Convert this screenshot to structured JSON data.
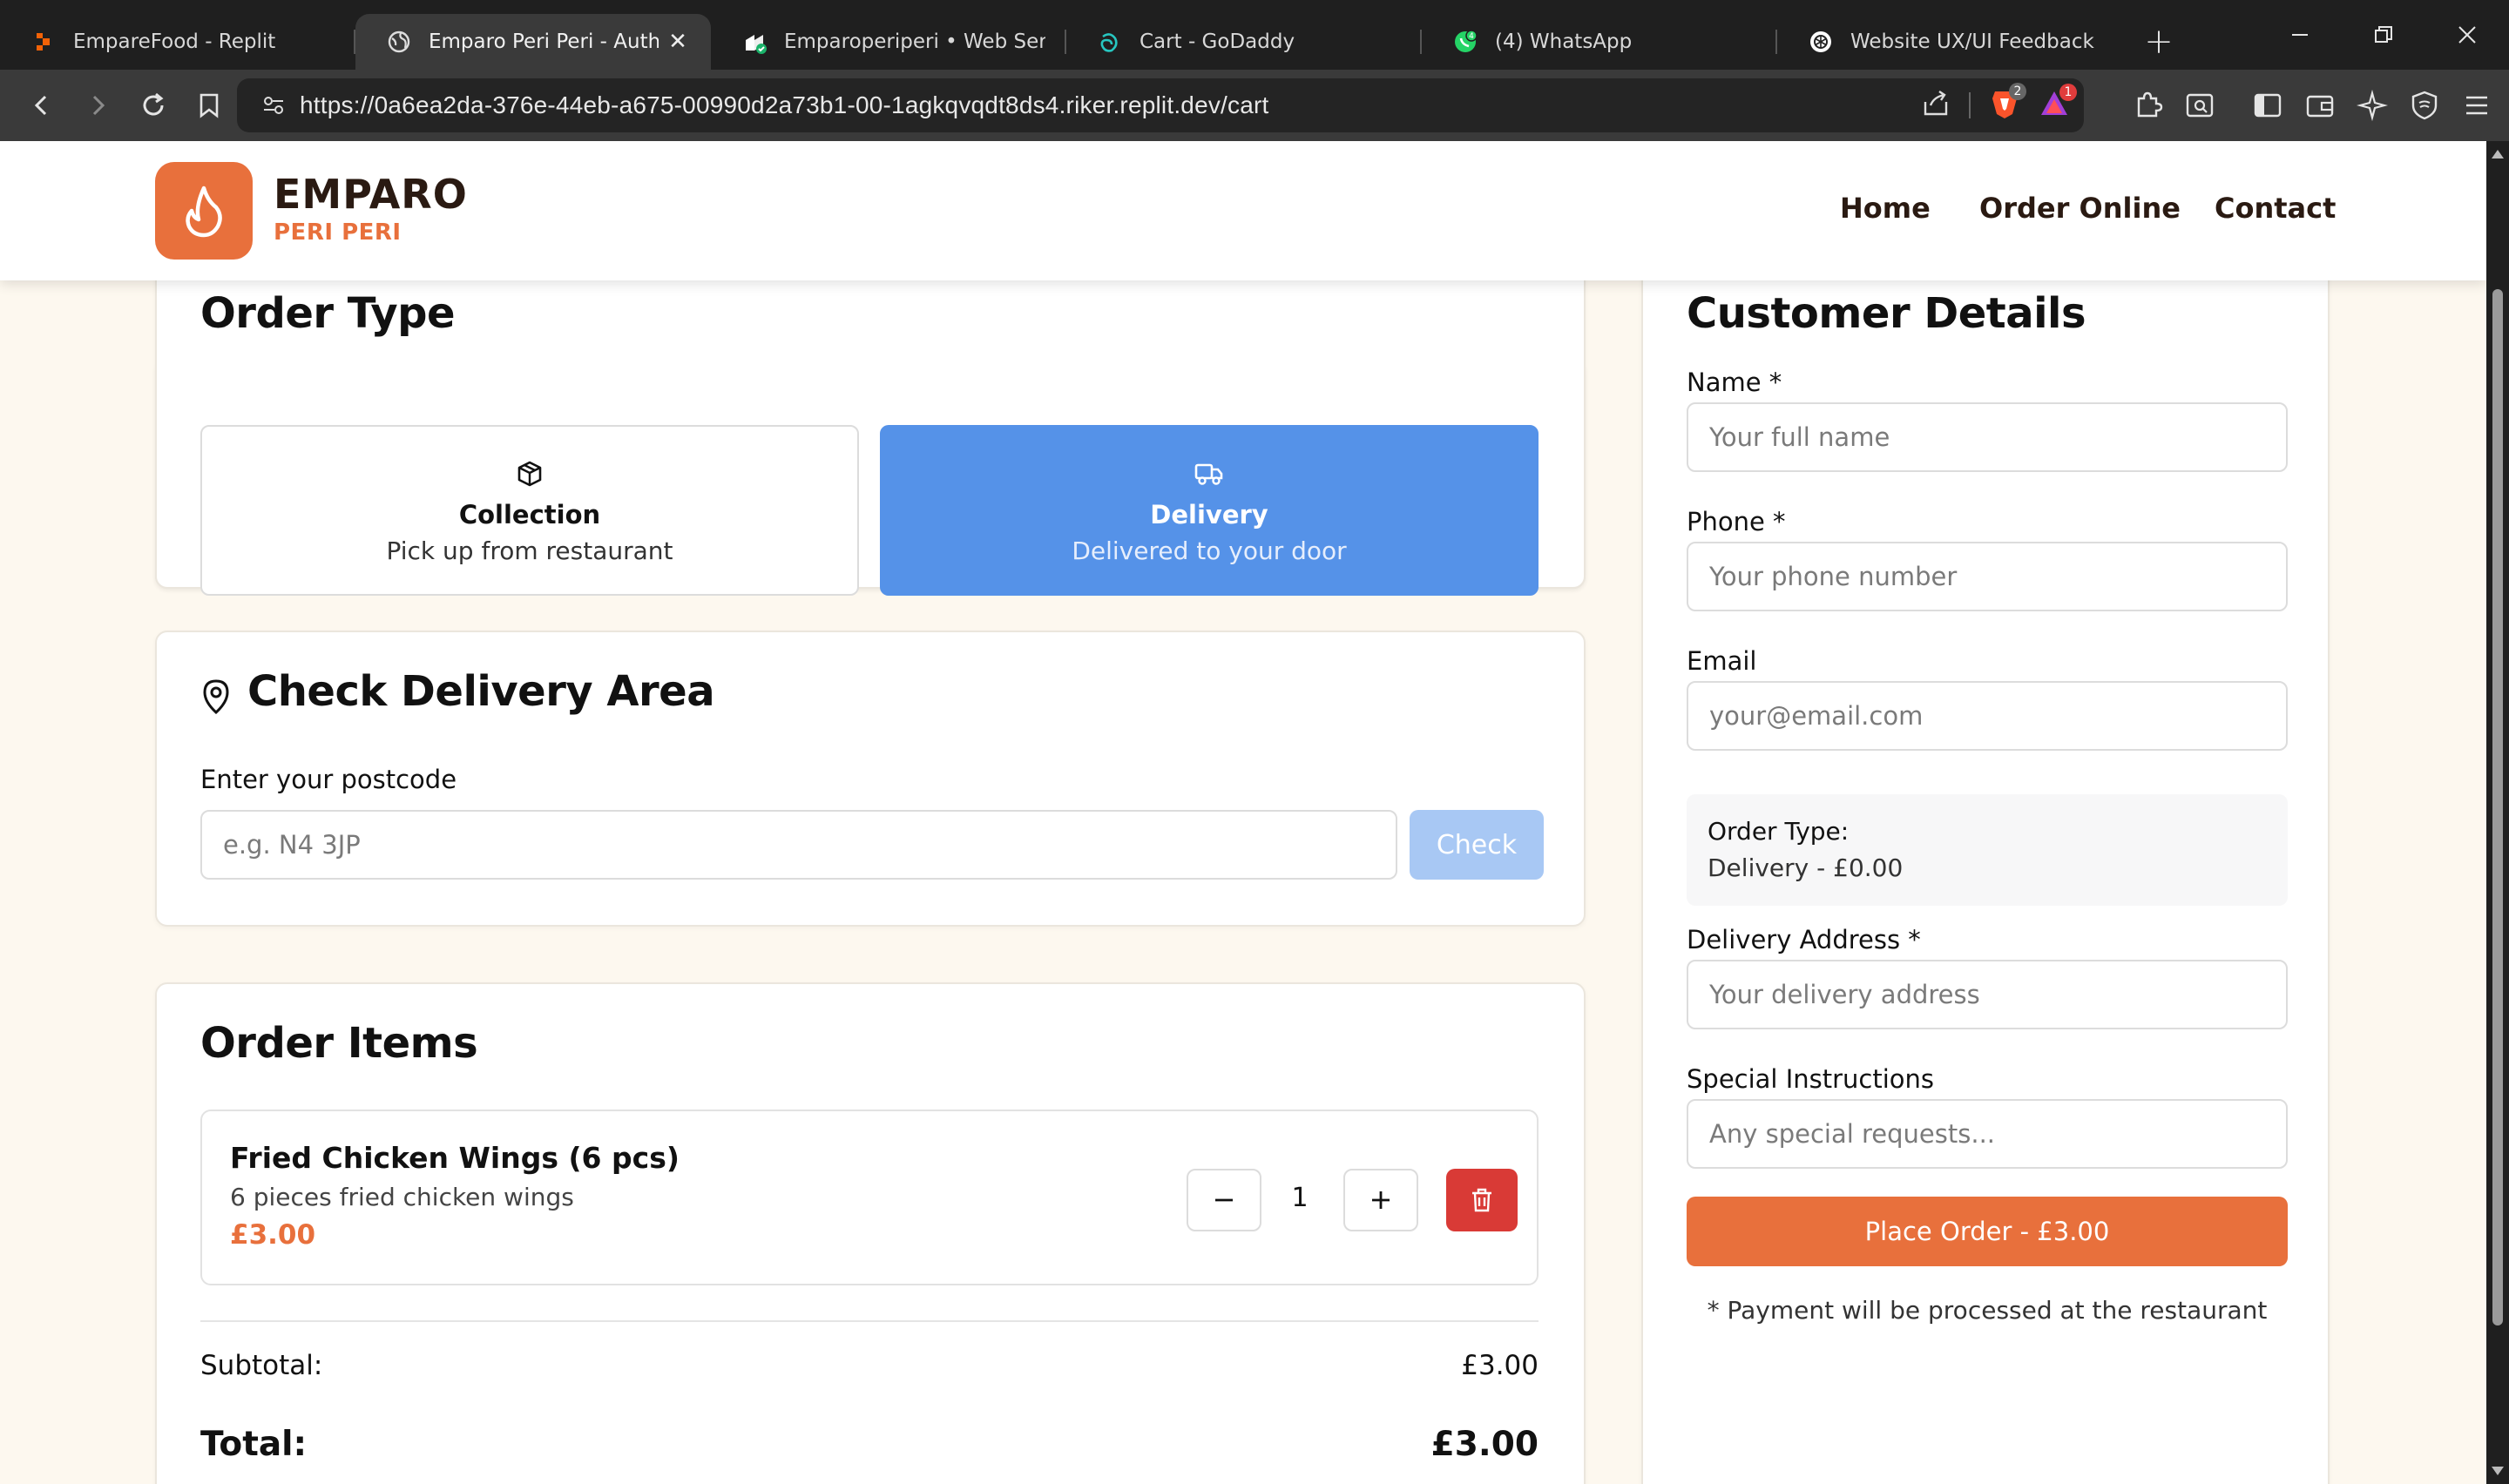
{
  "browser": {
    "tabs": [
      {
        "title": "EmpareFood - Replit",
        "icon": "replit-icon",
        "active": false
      },
      {
        "title": "Emparo Peri Peri - Authen",
        "icon": "globe-icon",
        "active": true
      },
      {
        "title": "Emparoperiperi • Web Servic",
        "icon": "godaddy-service-icon",
        "active": false
      },
      {
        "title": "Cart - GoDaddy",
        "icon": "godaddy-icon",
        "active": false
      },
      {
        "title": "(4) WhatsApp",
        "icon": "whatsapp-icon",
        "active": false
      },
      {
        "title": "Website UX/UI Feedback",
        "icon": "openai-icon",
        "active": false
      }
    ],
    "url": "https://0a6ea2da-376e-44eb-a675-00990d2a73b1-00-1agkqvqdt8ds4.riker.replit.dev/cart",
    "brave_badge": "2",
    "rewards_badge": "1"
  },
  "header": {
    "brand_name": "EMPARO",
    "brand_sub": "PERI PERI",
    "nav": {
      "home": "Home",
      "order_online": "Order Online",
      "contact": "Contact"
    }
  },
  "order_type": {
    "title": "Order Type",
    "collection": {
      "title": "Collection",
      "subtitle": "Pick up from restaurant"
    },
    "delivery": {
      "title": "Delivery",
      "subtitle": "Delivered to your door"
    },
    "selected": "delivery"
  },
  "delivery_area": {
    "title": "Check Delivery Area",
    "postcode_label": "Enter your postcode",
    "postcode_placeholder": "e.g. N4 3JP",
    "check_label": "Check"
  },
  "order_items": {
    "title": "Order Items",
    "items": [
      {
        "name": "Fried Chicken Wings (6 pcs)",
        "description": "6 pieces fried chicken wings",
        "price": "£3.00",
        "quantity": "1"
      }
    ],
    "subtotal_label": "Subtotal:",
    "subtotal_value": "£3.00",
    "total_label": "Total:",
    "total_value": "£3.00"
  },
  "customer": {
    "title": "Customer Details",
    "name_label": "Name *",
    "name_placeholder": "Your full name",
    "phone_label": "Phone *",
    "phone_placeholder": "Your phone number",
    "email_label": "Email",
    "email_placeholder": "your@email.com",
    "order_type_label": "Order Type:",
    "order_type_value": "Delivery - £0.00",
    "address_label": "Delivery Address *",
    "address_placeholder": "Your delivery address",
    "instructions_label": "Special Instructions",
    "instructions_placeholder": "Any special requests...",
    "place_order_label": "Place Order - £3.00",
    "payment_note": "* Payment will be processed at the restaurant"
  },
  "colors": {
    "accent": "#e8703c",
    "selected": "#5592e8",
    "delete": "#d93a36",
    "page_bg": "#fdf8ef"
  }
}
